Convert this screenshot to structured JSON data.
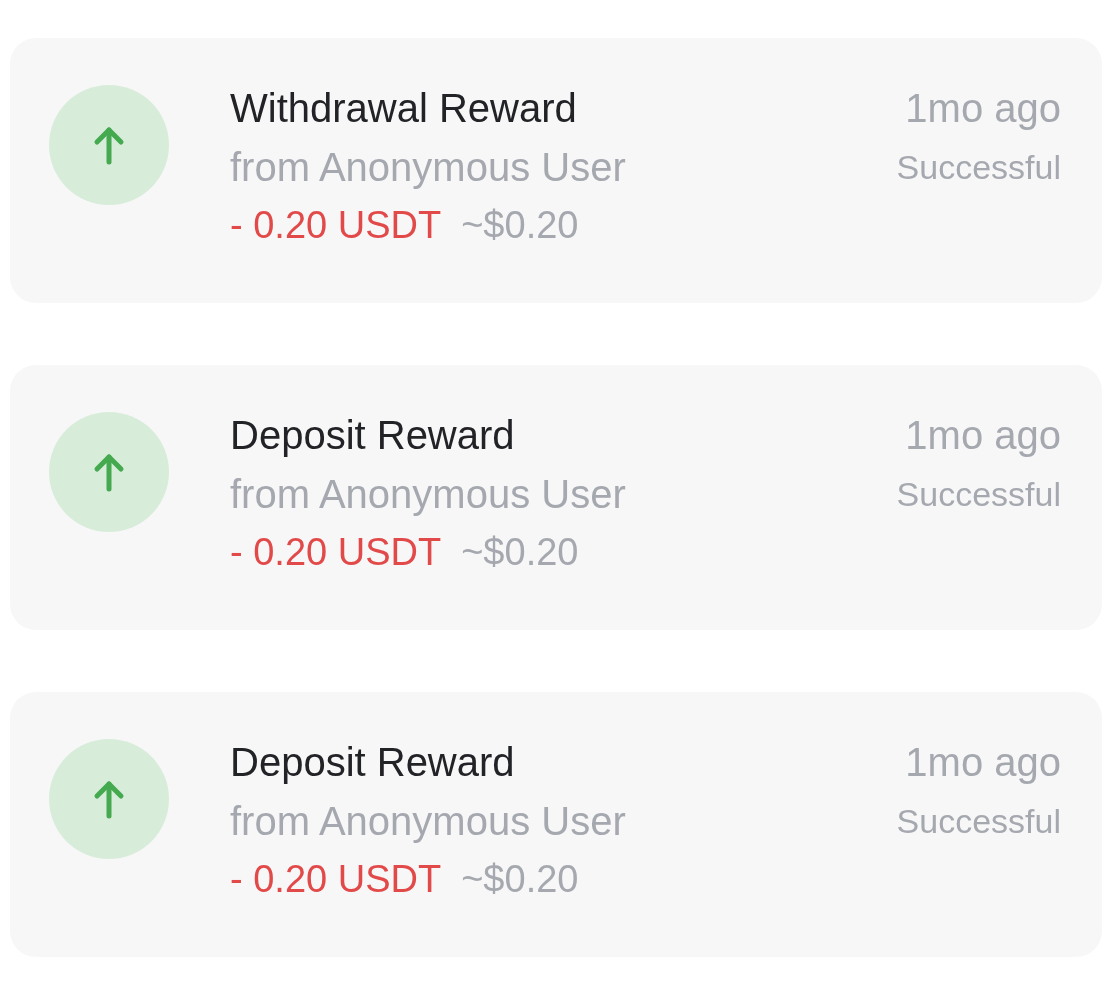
{
  "transactions": [
    {
      "title": "Withdrawal Reward",
      "source": "from Anonymous User",
      "amount": "- 0.20 USDT",
      "fiat_value": "~$0.20",
      "time": "1mo ago",
      "status": "Successful"
    },
    {
      "title": "Deposit Reward",
      "source": "from Anonymous User",
      "amount": "- 0.20 USDT",
      "fiat_value": "~$0.20",
      "time": "1mo ago",
      "status": "Successful"
    },
    {
      "title": "Deposit Reward",
      "source": "from Anonymous User",
      "amount": "- 0.20 USDT",
      "fiat_value": "~$0.20",
      "time": "1mo ago",
      "status": "Successful"
    }
  ]
}
